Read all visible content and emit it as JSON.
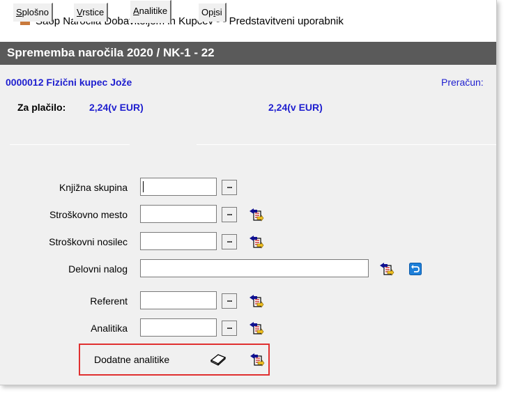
{
  "window": {
    "title": "Saop   Naročila Dobaviteljem in Kupcev -  - Predstavitveni uporabnik"
  },
  "dialog": {
    "title": "Sprememba naročila 2020 / NK-1 - 22"
  },
  "customer": {
    "text": "0000012 Fizični kupec Jože",
    "prerac": "Preračun:"
  },
  "payment": {
    "label": "Za plačilo:",
    "value1": "2,24(v EUR)",
    "value2": "2,24(v EUR)"
  },
  "tabs": [
    {
      "pre": "",
      "u": "S",
      "post": "plošno"
    },
    {
      "pre": "",
      "u": "V",
      "post": "rstice"
    },
    {
      "pre": "",
      "u": "A",
      "post": "nalitike"
    },
    {
      "pre": "Op",
      "u": "i",
      "post": "si"
    }
  ],
  "fields": {
    "knjizna": {
      "label": "Knjižna skupina",
      "value": "",
      "button": "..."
    },
    "strosk_mesto": {
      "label": "Stroškovno mesto",
      "value": "",
      "button": "..."
    },
    "strosk_nosilec": {
      "label": "Stroškovni  nosilec",
      "value": "",
      "button": "..."
    },
    "delovni": {
      "label": "Delovni nalog",
      "value": ""
    },
    "referent": {
      "label": "Referent",
      "value": "",
      "button": "..."
    },
    "analitika": {
      "label": "Analitika",
      "value": "",
      "button": "..."
    }
  },
  "dodatne": {
    "label": "Dodatne analitike"
  },
  "icons": {
    "app": "folder-app-icon",
    "picker": "data-picker-icon",
    "undo": "undo-icon",
    "book": "book-icon"
  }
}
